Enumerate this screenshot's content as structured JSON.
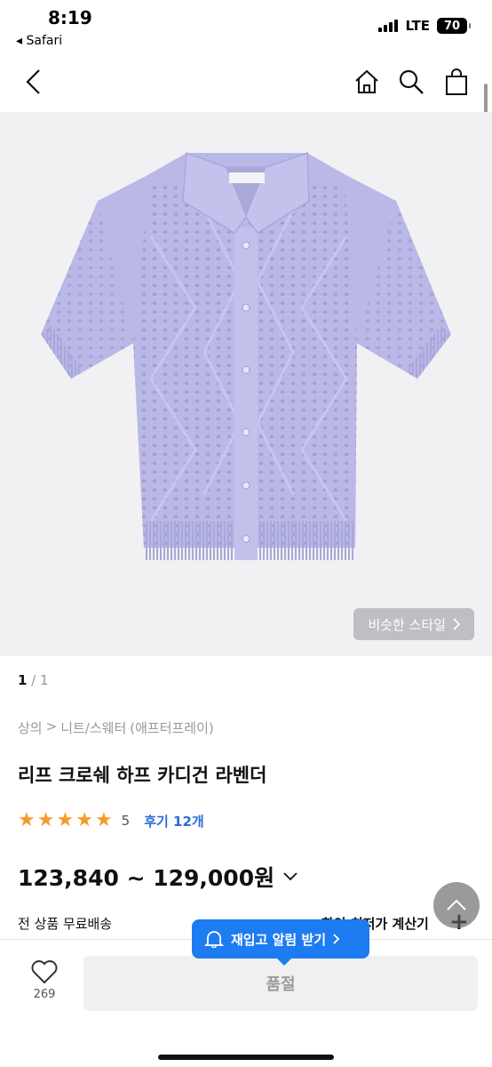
{
  "status": {
    "time": "8:19",
    "back_app": "◂ Safari",
    "network": "LTE",
    "battery": "70"
  },
  "product": {
    "pager_current": "1",
    "pager_total": "/ 1",
    "similar_style": "비슷한 스타일",
    "breadcrumb": {
      "category": "상의",
      "separator": ">",
      "subcategory": "니트/스웨터",
      "brand": "(애프터프레이)"
    },
    "title": "리프 크로쉐 하프 카디건 라벤더",
    "rating_stars": 5,
    "rating_score": "5",
    "reviews": "후기 12개",
    "price": "123,840 ~ 129,000원",
    "shipping": "전 상품 무료배송",
    "calculator": "최대 할인 적용가 계산기",
    "calculator_visible": "할인 최저가 계산기"
  },
  "restock": {
    "label": "재입고 알림 받기"
  },
  "bottom": {
    "likes": "269",
    "soldout": "품절"
  },
  "colors": {
    "accent": "#1e7cf2",
    "star": "#f39c2b",
    "link": "#2b6cd8",
    "cardigan": "#b9b8e6"
  }
}
